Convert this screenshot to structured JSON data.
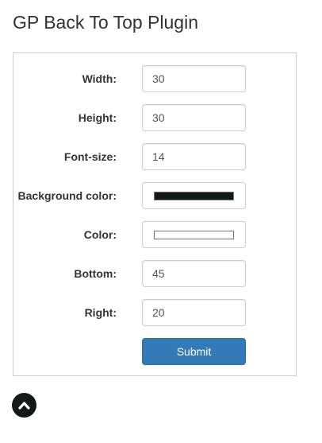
{
  "page": {
    "title": "GP Back To Top Plugin"
  },
  "form": {
    "fields": [
      {
        "label": "Width:",
        "value": "30"
      },
      {
        "label": "Height:",
        "value": "30"
      },
      {
        "label": "Font-size:",
        "value": "14"
      },
      {
        "label": "Background color:",
        "color": "#111a17"
      },
      {
        "label": "Color:",
        "color": "#ffffff"
      },
      {
        "label": "Bottom:",
        "value": "45"
      },
      {
        "label": "Right:",
        "value": "20"
      }
    ],
    "submit_label": "Submit"
  },
  "back_to_top": {
    "icon": "chevron-up-icon",
    "background": "#111a17",
    "icon_color": "#ffffff"
  }
}
